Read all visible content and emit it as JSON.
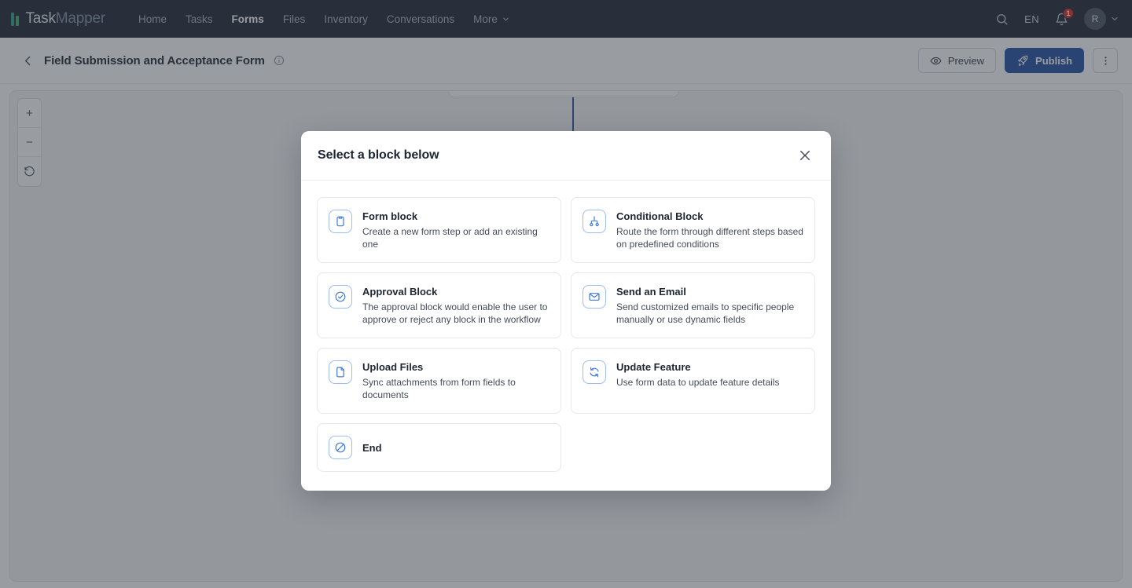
{
  "topnav": {
    "logo": {
      "task": "Task",
      "mapper": "Mapper"
    },
    "links": [
      {
        "label": "Home",
        "active": false
      },
      {
        "label": "Tasks",
        "active": false
      },
      {
        "label": "Forms",
        "active": true
      },
      {
        "label": "Files",
        "active": false
      },
      {
        "label": "Inventory",
        "active": false
      },
      {
        "label": "Conversations",
        "active": false
      },
      {
        "label": "More",
        "active": false
      }
    ],
    "search_icon": "search-icon",
    "language": "EN",
    "notifications": {
      "icon": "bell-icon",
      "count": "1"
    },
    "avatar": {
      "initial": "R",
      "chevron": "chevron-down-icon"
    }
  },
  "subheader": {
    "back_icon": "chevron-left-icon",
    "title": "Field Submission and Acceptance Form",
    "info_icon": "info-circle-icon",
    "preview_label": "Preview",
    "preview_icon": "eye-icon",
    "publish_label": "Publish",
    "publish_icon": "rocket-icon",
    "kebab_icon": "more-vertical-icon",
    "accent_color": "#1e4fa3"
  },
  "canvas": {
    "zoom_in_label": "+",
    "zoom_out_label": "−",
    "reset_icon": "reset-rotate-icon",
    "node_dot_color": "#e0900f",
    "connector_color": "#2850a7"
  },
  "modal": {
    "title": "Select a block below",
    "close_icon": "close-icon",
    "blocks": [
      {
        "title": "Form block",
        "desc": "Create a new form step or add an existing one",
        "icon": "clipboard-icon"
      },
      {
        "title": "Conditional Block",
        "desc": "Route the form through different steps based on predefined conditions",
        "icon": "branch-split-icon"
      },
      {
        "title": "Approval Block",
        "desc": "The approval block would enable the user to approve or reject any block in the workflow",
        "icon": "check-circle-icon"
      },
      {
        "title": "Send an Email",
        "desc": "Send customized emails to specific people manually or use dynamic fields",
        "icon": "envelope-icon"
      },
      {
        "title": "Upload Files",
        "desc": "Sync attachments from form fields to documents",
        "icon": "file-icon"
      },
      {
        "title": "Update Feature",
        "desc": "Use form data to update feature details",
        "icon": "refresh-icon"
      },
      {
        "title": "End",
        "desc": "",
        "icon": "ban-circle-icon"
      }
    ]
  }
}
